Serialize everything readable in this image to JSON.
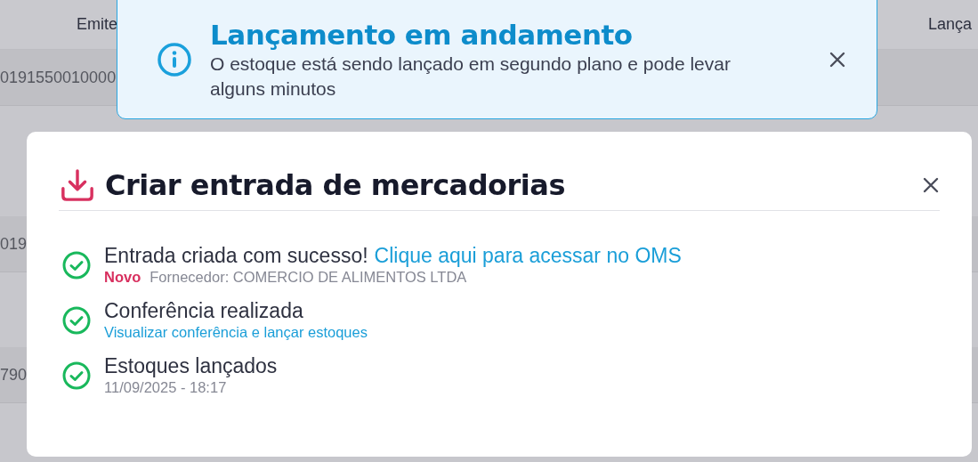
{
  "background_table": {
    "columns": [
      {
        "label": "Emite"
      },
      {
        "label": "Lança"
      }
    ],
    "rows": [
      {
        "column_1": "0191550010000"
      },
      {
        "column_1": "019"
      },
      {
        "column_1": "790"
      }
    ]
  },
  "toast": {
    "title": "Lançamento em andamento",
    "message": "O estoque está sendo lançado em segundo plano e pode levar alguns minutos"
  },
  "dialog": {
    "title": "Criar entrada de mercadorias",
    "steps": [
      {
        "done": true,
        "title": "Entrada criada com sucesso!",
        "title_link": "Clique aqui para acessar no OMS",
        "kind": "badge_meta",
        "badge": "Novo",
        "detail": "Fornecedor: COMERCIO DE ALIMENTOS LTDA"
      },
      {
        "done": true,
        "title": "Conferência realizada",
        "kind": "link",
        "detail": "Visualizar conferência e lançar estoques"
      },
      {
        "done": true,
        "title": "Estoques lançados",
        "kind": "text",
        "detail": "11/09/2025 - 18:17"
      }
    ]
  }
}
